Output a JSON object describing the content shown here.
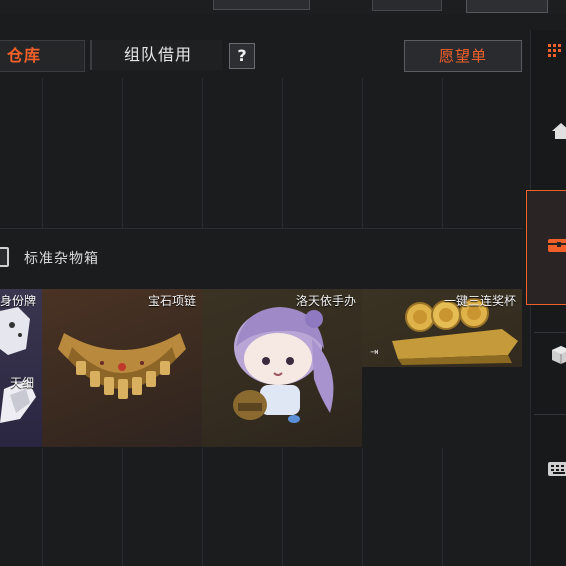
{
  "tabs": {
    "warehouse": "仓库",
    "team_borrow": "组队借用",
    "help": "?",
    "wishlist": "愿望单"
  },
  "section": {
    "title": "标准杂物箱"
  },
  "items": [
    {
      "label_top": "身份牌",
      "label_bottom": "天细"
    },
    {
      "label": "宝石项链"
    },
    {
      "label": "洛天依手办"
    },
    {
      "label": "一键三连奖杯"
    }
  ],
  "colors": {
    "accent": "#f2602a",
    "background": "#1b1c1e"
  },
  "sidebar_icons": [
    "grid-menu-icon",
    "home-icon",
    "chest-icon",
    "cube-icon",
    "keyboard-icon"
  ]
}
